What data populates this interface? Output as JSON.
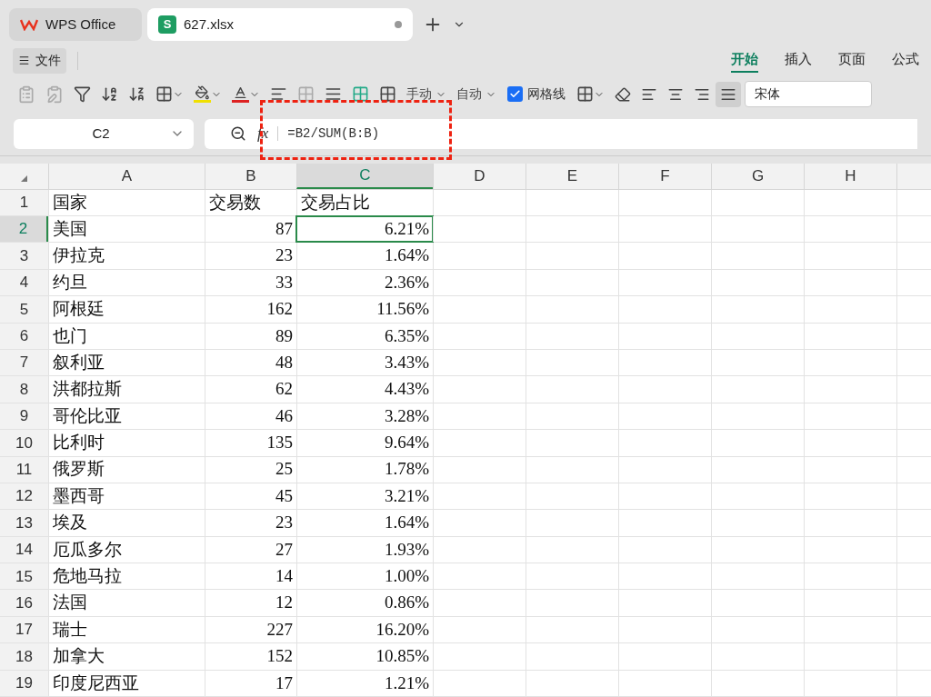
{
  "tabs": [
    {
      "kind": "home",
      "label": "WPS Office",
      "selected": false
    },
    {
      "kind": "sheet",
      "label": "627.xlsx",
      "selected": true,
      "badge": "S"
    }
  ],
  "menu": {
    "file": "文件",
    "ribbon_tabs": [
      {
        "label": "开始",
        "selected": true
      },
      {
        "label": "插入",
        "selected": false
      },
      {
        "label": "页面",
        "selected": false
      },
      {
        "label": "公式",
        "selected": false
      }
    ]
  },
  "toolbar": {
    "row_height": "手动",
    "col_width": "自动",
    "gridlines": {
      "label": "网格线",
      "checked": true
    },
    "align": [
      {
        "selected": false
      },
      {
        "selected": false
      },
      {
        "selected": false
      },
      {
        "selected": true
      }
    ],
    "font": "宋体"
  },
  "formula_bar": {
    "name_box": "C2",
    "fx": "fx",
    "formula": "=B2/SUM(B:B)"
  },
  "grid": {
    "columns": [
      {
        "label": "A",
        "selected": false
      },
      {
        "label": "B",
        "selected": false
      },
      {
        "label": "C",
        "selected": true
      },
      {
        "label": "D",
        "selected": false
      },
      {
        "label": "E",
        "selected": false
      },
      {
        "label": "F",
        "selected": false
      },
      {
        "label": "G",
        "selected": false
      },
      {
        "label": "H",
        "selected": false
      }
    ],
    "rows": [
      {
        "header": "1",
        "selected": false,
        "cells": [
          "国家",
          "交易数",
          "交易占比"
        ]
      },
      {
        "header": "2",
        "selected": true,
        "cells": [
          "美国",
          "87",
          "6.21%"
        ]
      },
      {
        "header": "3",
        "selected": false,
        "cells": [
          "伊拉克",
          "23",
          "1.64%"
        ]
      },
      {
        "header": "4",
        "selected": false,
        "cells": [
          "约旦",
          "33",
          "2.36%"
        ]
      },
      {
        "header": "5",
        "selected": false,
        "cells": [
          "阿根廷",
          "162",
          "11.56%"
        ]
      },
      {
        "header": "6",
        "selected": false,
        "cells": [
          "也门",
          "89",
          "6.35%"
        ]
      },
      {
        "header": "7",
        "selected": false,
        "cells": [
          "叙利亚",
          "48",
          "3.43%"
        ]
      },
      {
        "header": "8",
        "selected": false,
        "cells": [
          "洪都拉斯",
          "62",
          "4.43%"
        ]
      },
      {
        "header": "9",
        "selected": false,
        "cells": [
          "哥伦比亚",
          "46",
          "3.28%"
        ]
      },
      {
        "header": "10",
        "selected": false,
        "cells": [
          "比利时",
          "135",
          "9.64%"
        ]
      },
      {
        "header": "11",
        "selected": false,
        "cells": [
          "俄罗斯",
          "25",
          "1.78%"
        ]
      },
      {
        "header": "12",
        "selected": false,
        "cells": [
          "墨西哥",
          "45",
          "3.21%"
        ]
      },
      {
        "header": "13",
        "selected": false,
        "cells": [
          "埃及",
          "23",
          "1.64%"
        ]
      },
      {
        "header": "14",
        "selected": false,
        "cells": [
          "厄瓜多尔",
          "27",
          "1.93%"
        ]
      },
      {
        "header": "15",
        "selected": false,
        "cells": [
          "危地马拉",
          "14",
          "1.00%"
        ]
      },
      {
        "header": "16",
        "selected": false,
        "cells": [
          "法国",
          "12",
          "0.86%"
        ]
      },
      {
        "header": "17",
        "selected": false,
        "cells": [
          "瑞士",
          "227",
          "16.20%"
        ]
      },
      {
        "header": "18",
        "selected": false,
        "cells": [
          "加拿大",
          "152",
          "10.85%"
        ]
      },
      {
        "header": "19",
        "selected": false,
        "cells": [
          "印度尼西亚",
          "17",
          "1.21%"
        ]
      }
    ]
  }
}
